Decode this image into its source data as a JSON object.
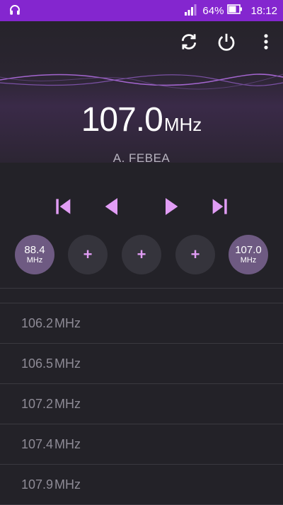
{
  "status_bar": {
    "battery_percent": "64%",
    "time": "18:12",
    "color": "#8426cf"
  },
  "toolbar": {
    "icons": [
      "refresh-icon",
      "power-icon",
      "more-vert-icon"
    ]
  },
  "tuner": {
    "frequency": "107.0",
    "unit": "MHz",
    "station_name": "A. FEBEA",
    "accent": "#e19df5"
  },
  "controls": [
    "skip-previous-icon",
    "step-back-icon",
    "step-forward-icon",
    "skip-next-icon"
  ],
  "presets": [
    {
      "type": "filled",
      "value": "88.4",
      "unit": "MHz"
    },
    {
      "type": "empty",
      "symbol": "+"
    },
    {
      "type": "empty",
      "symbol": "+"
    },
    {
      "type": "empty",
      "symbol": "+"
    },
    {
      "type": "filled",
      "value": "107.0",
      "unit": "MHz"
    }
  ],
  "stations": [
    {
      "freq": "106.2",
      "unit": "MHz"
    },
    {
      "freq": "106.5",
      "unit": "MHz"
    },
    {
      "freq": "107.2",
      "unit": "MHz"
    },
    {
      "freq": "107.4",
      "unit": "MHz"
    },
    {
      "freq": "107.9",
      "unit": "MHz"
    }
  ]
}
